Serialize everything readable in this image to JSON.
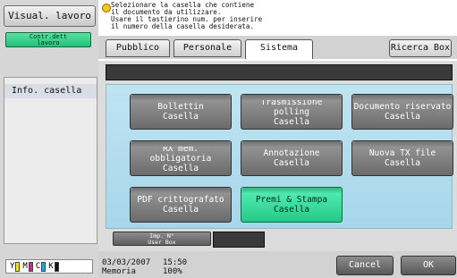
{
  "left": {
    "visual_label": "Visual. lavoro",
    "contr_line1": "Contr.dett",
    "contr_line2": "lavoro",
    "panel_title": "Info. casella",
    "toner": [
      "Y",
      "M",
      "C",
      "K"
    ],
    "colors": {
      "Y": "#f2e224",
      "M": "#d6238f",
      "C": "#27a7de",
      "K": "#111111"
    }
  },
  "message": {
    "line1": "Selezionare la casella che contiene",
    "line2": "il documento da utilizzare.",
    "line3": "Usare il tastierino num. per inserire",
    "line4": "il numero della casella desiderata."
  },
  "tabs": [
    {
      "label": "Pubblico",
      "active": false
    },
    {
      "label": "Personale",
      "active": false
    },
    {
      "label": "Sistema",
      "active": true
    }
  ],
  "ricerca_label": "Ricerca Box",
  "boxes": [
    {
      "line1": "Bollettin",
      "line2": "Casella",
      "highlighted": false
    },
    {
      "line1": "Trasmissione polling",
      "line2": "Casella",
      "highlighted": false
    },
    {
      "line1": "Documento riservato",
      "line2": "Casella",
      "highlighted": false
    },
    {
      "line1": "RX mem. obbligatoria",
      "line2": "Casella",
      "highlighted": false
    },
    {
      "line1": "Annotazione",
      "line2": "Casella",
      "highlighted": false
    },
    {
      "line1": "Nuova TX file",
      "line2": "Casella",
      "highlighted": false
    },
    {
      "line1": "PDF crittografato",
      "line2": "Casella",
      "highlighted": false
    },
    {
      "line1": "Premi & Stampa",
      "line2": "Casella",
      "highlighted": true
    }
  ],
  "imp": {
    "line1": "Imp. N°",
    "line2": "User Box"
  },
  "status": {
    "date": "03/03/2007",
    "time": "15:50",
    "memory_label": "Memoria",
    "memory_value": "100%"
  },
  "buttons": {
    "cancel": "Cancel",
    "ok": "OK"
  }
}
